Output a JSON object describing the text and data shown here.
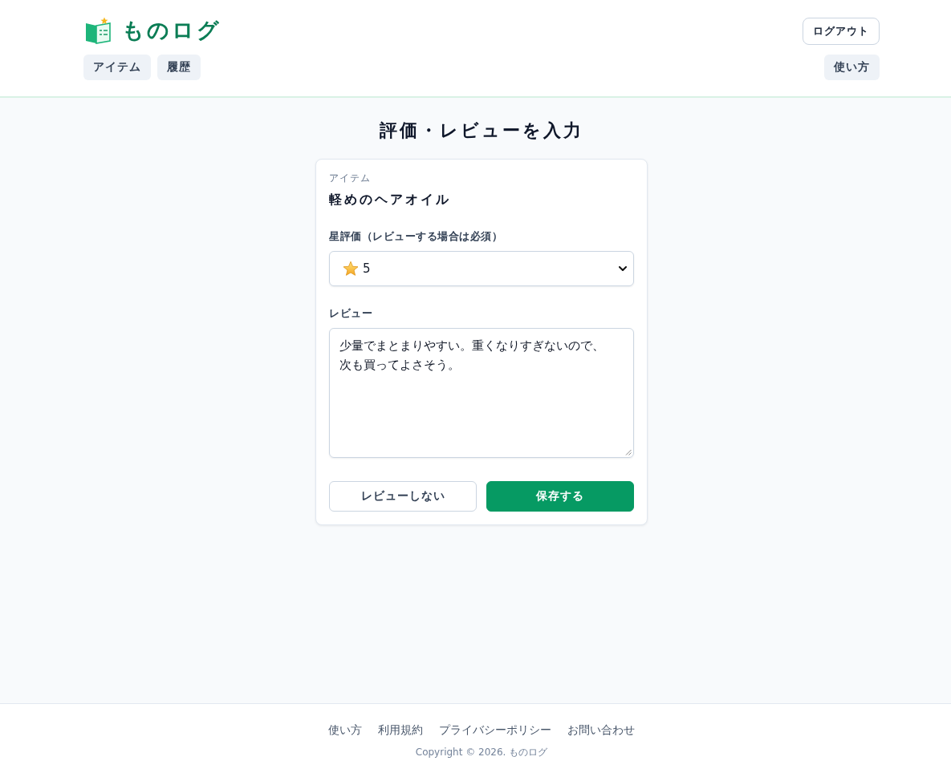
{
  "header": {
    "logo": {
      "text": "ものログ"
    },
    "nav": [
      {
        "label": "アイテム"
      },
      {
        "label": "履歴"
      }
    ],
    "logout": "ログアウト",
    "help": "使い方"
  },
  "page_title": "評価・レビューを入力",
  "form": {
    "item_label": "アイテム",
    "item_name": "軽めのヘアオイル",
    "rating": {
      "label": "星評価（レビューする場合は必須）",
      "value": "5"
    },
    "review": {
      "label": "レビュー",
      "value": "少量でまとまりやすい。重くなりすぎないので、次も買ってよさそう。"
    },
    "buttons": [
      {
        "label": "レビューしない",
        "kind": "secondary"
      },
      {
        "label": "保存する",
        "kind": "primary"
      }
    ]
  },
  "footer": {
    "links": [
      "使い方",
      "利用規約",
      "プライバシーポリシー",
      "お問い合わせ"
    ],
    "copyright": "Copyright © 2026. ものログ"
  }
}
